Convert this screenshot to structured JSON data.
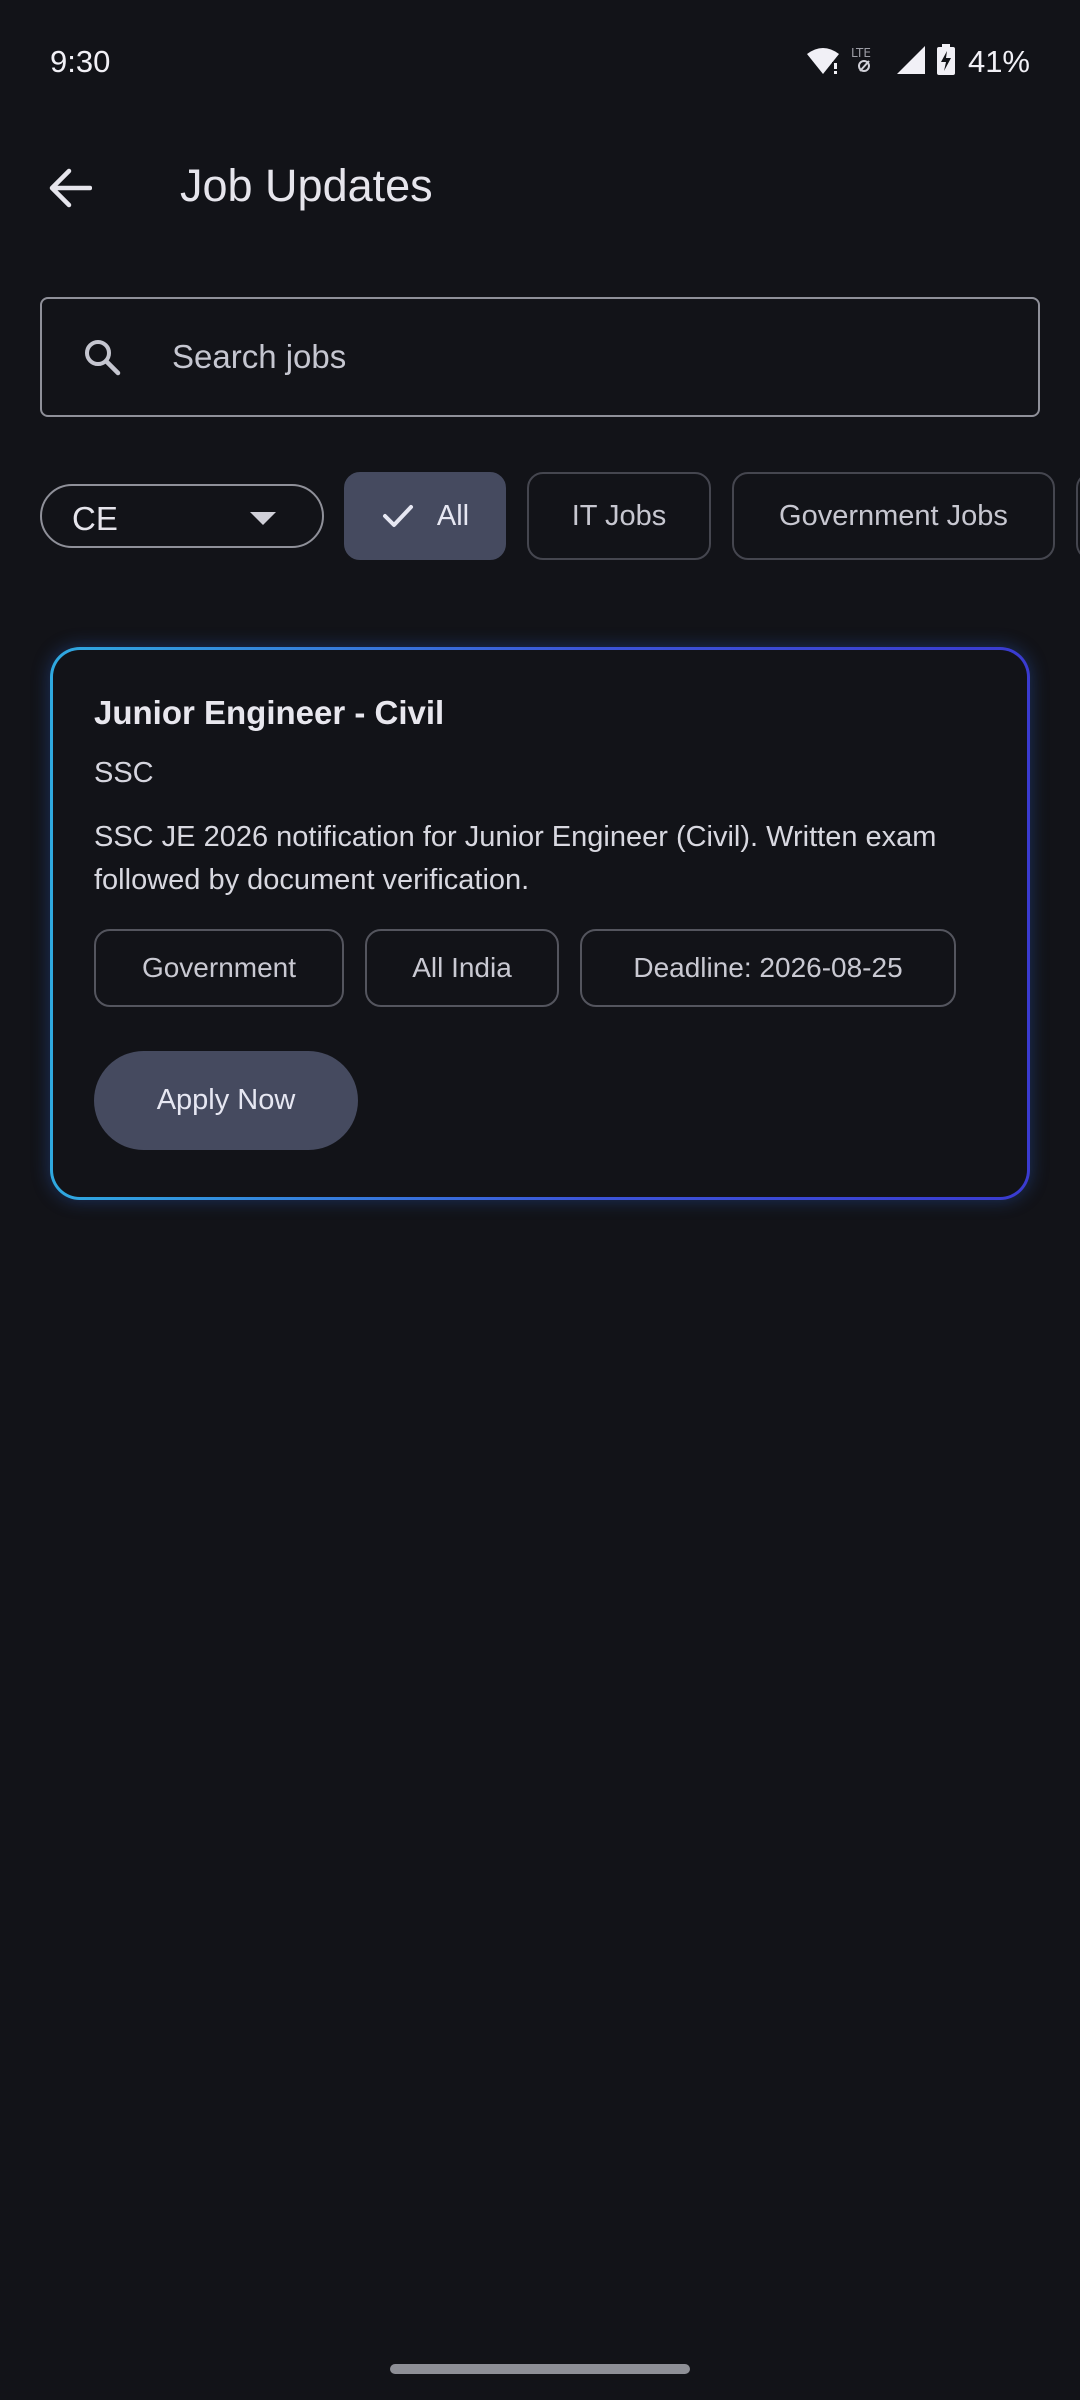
{
  "status_bar": {
    "time": "9:30",
    "battery": "41%",
    "icons": [
      "wifi-icon",
      "lte-icon",
      "signal-icon",
      "battery-charging-icon"
    ]
  },
  "app_bar": {
    "back_icon": "arrow-back-icon",
    "title": "Job Updates"
  },
  "search": {
    "placeholder": "Search jobs",
    "value": "",
    "icon": "search-icon"
  },
  "filters": {
    "branch_dropdown": {
      "value": "CE",
      "icon": "dropdown-caret-icon"
    },
    "chips": [
      {
        "label": "All",
        "selected": true
      },
      {
        "label": "IT Jobs",
        "selected": false
      },
      {
        "label": "Government Jobs",
        "selected": false
      }
    ]
  },
  "jobs": [
    {
      "title": "Junior Engineer - Civil",
      "organization": "SSC",
      "description": "SSC JE 2026 notification for Junior Engineer (Civil). Written exam followed by document verification.",
      "tags": [
        "Government",
        "All India",
        "Deadline: 2026-08-25"
      ],
      "action_label": "Apply Now"
    }
  ],
  "colors": {
    "background": "#121318",
    "selected_chip": "#454a5f",
    "card_border_start": "#2fa9e0",
    "card_border_end": "#3a3bd0"
  }
}
